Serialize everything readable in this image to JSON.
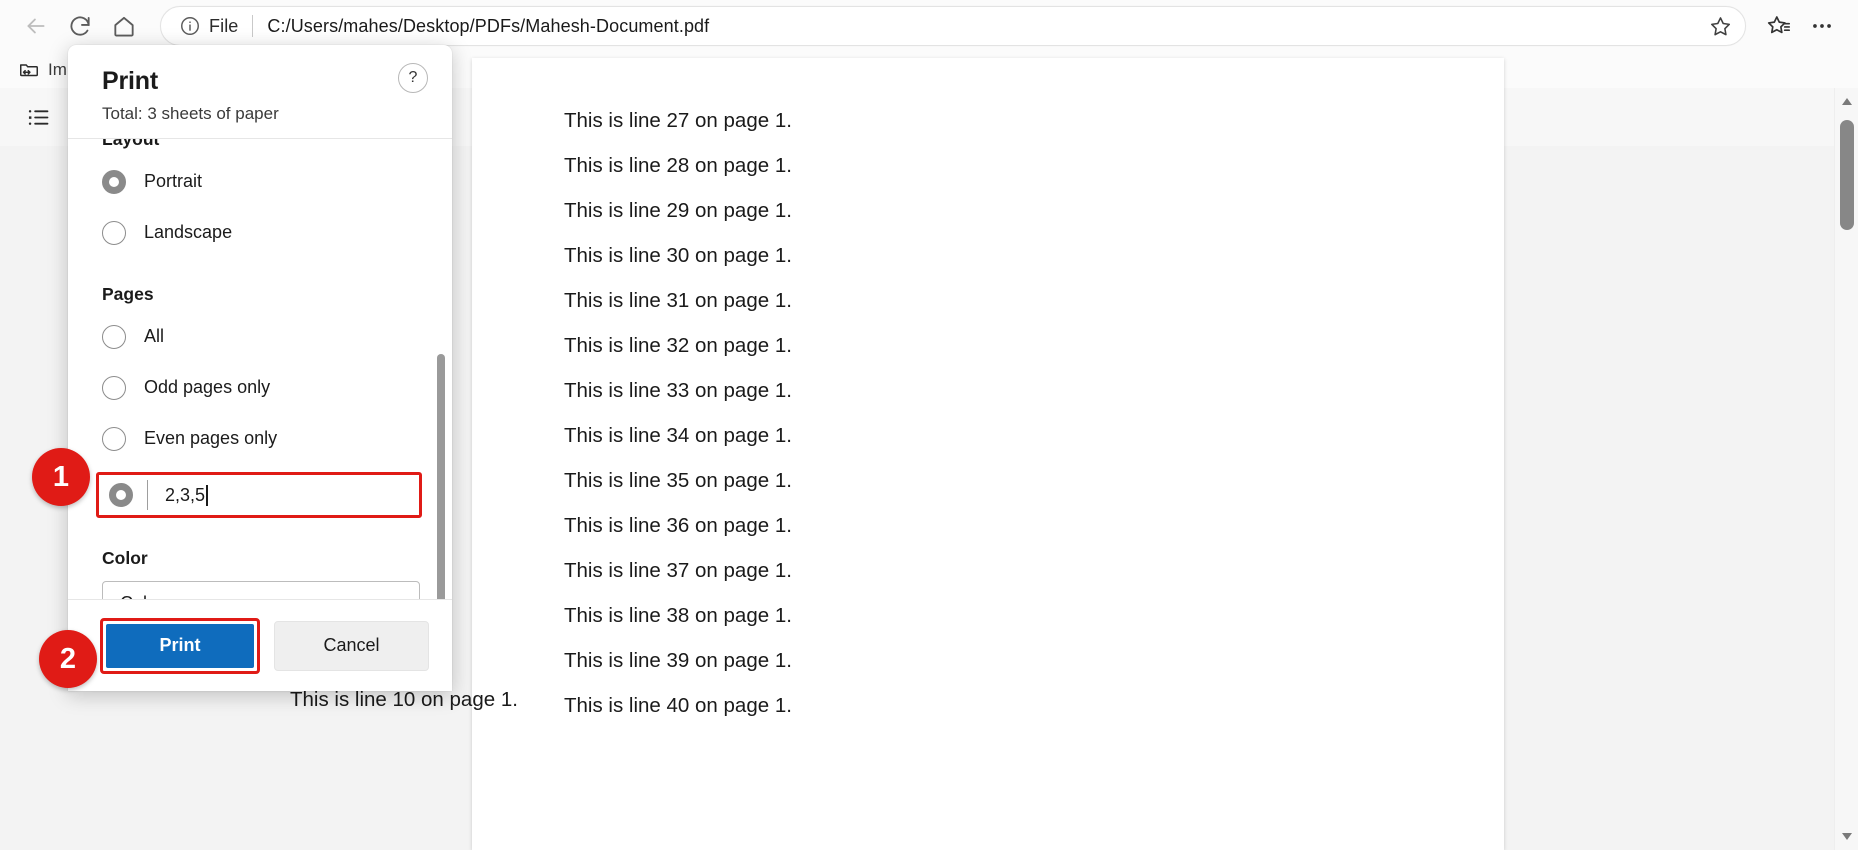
{
  "browser": {
    "nav": {
      "back_icon": "arrow-left-icon",
      "refresh_icon": "refresh-icon",
      "home_icon": "home-icon"
    },
    "omnibox": {
      "info_icon": "info-circle-icon",
      "scheme_label": "File",
      "url": "C:/Users/mahes/Desktop/PDFs/Mahesh-Document.pdf",
      "favorite_icon": "star-outline-icon"
    },
    "collections_icon": "collections-star-icon",
    "settings_icon": "ellipsis-horizontal-icon",
    "bookmarks": [
      {
        "icon": "import-favorites-icon",
        "label": "Import favorites"
      }
    ]
  },
  "pdf_toolbar": {
    "toc_icon": "table-of-contents-icon"
  },
  "pdf_document": {
    "lines": [
      "This is line 27 on page 1.",
      "This is line 28 on page 1.",
      "This is line 29 on page 1.",
      "This is line 30 on page 1.",
      "This is line 31 on page 1.",
      "This is line 32 on page 1.",
      "This is line 33 on page 1.",
      "This is line 34 on page 1.",
      "This is line 35 on page 1.",
      "This is line 36 on page 1.",
      "This is line 37 on page 1.",
      "This is line 38 on page 1.",
      "This is line 39 on page 1.",
      "This is line 40 on page 1."
    ],
    "partial_line_behind_dialog": "This is line 10 on page 1."
  },
  "print_dialog": {
    "title": "Print",
    "subtitle": "Total: 3 sheets of paper",
    "help_label": "?",
    "layout": {
      "section_label": "Layout",
      "options": [
        {
          "label": "Portrait",
          "selected": true
        },
        {
          "label": "Landscape",
          "selected": false
        }
      ]
    },
    "pages": {
      "section_label": "Pages",
      "options": [
        {
          "label": "All",
          "selected": false
        },
        {
          "label": "Odd pages only",
          "selected": false
        },
        {
          "label": "Even pages only",
          "selected": false
        }
      ],
      "custom": {
        "selected": true,
        "value": "2,3,5"
      }
    },
    "color": {
      "section_label": "Color",
      "selected_value": "Color",
      "chevron_icon": "chevron-down-icon"
    },
    "footer": {
      "print_label": "Print",
      "cancel_label": "Cancel"
    }
  },
  "annotations": {
    "badges": [
      {
        "id": "1",
        "label": "1",
        "target": "custom-pages-input"
      },
      {
        "id": "2",
        "label": "2",
        "target": "print-button"
      }
    ],
    "highlight_color": "#E01B16",
    "accent_color": "#0F6CBD"
  }
}
